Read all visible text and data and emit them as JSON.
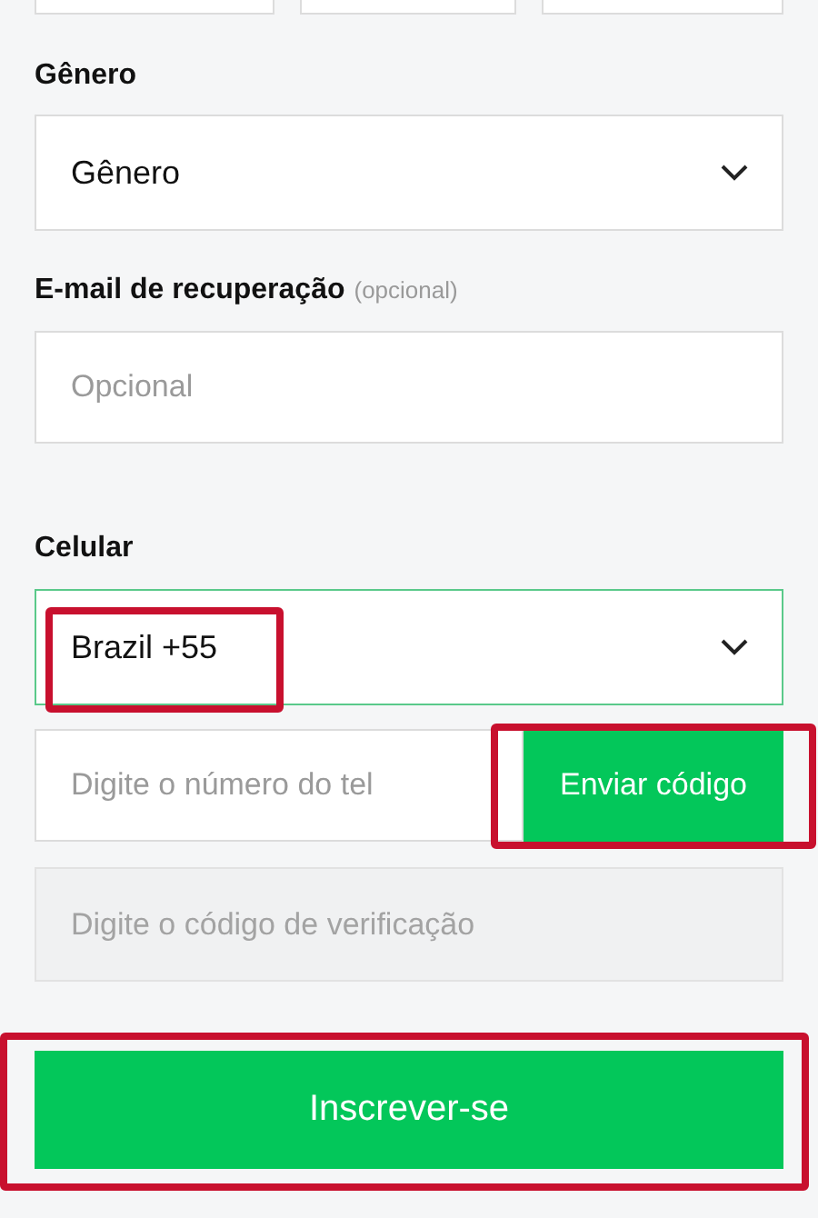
{
  "gender": {
    "label": "Gênero",
    "value": "Gênero"
  },
  "recovery_email": {
    "label": "E-mail de recuperação",
    "hint": "(opcional)",
    "placeholder": "Opcional"
  },
  "cellphone": {
    "label": "Celular",
    "country": {
      "value": "Brazil +55",
      "highlighted": true
    },
    "phone": {
      "placeholder": "Digite o número do tel"
    },
    "send_code": {
      "label": "Enviar código",
      "highlighted": true
    },
    "code": {
      "placeholder": "Digite o código de verificação",
      "disabled": true
    }
  },
  "submit": {
    "label": "Inscrever-se",
    "highlighted": true
  }
}
